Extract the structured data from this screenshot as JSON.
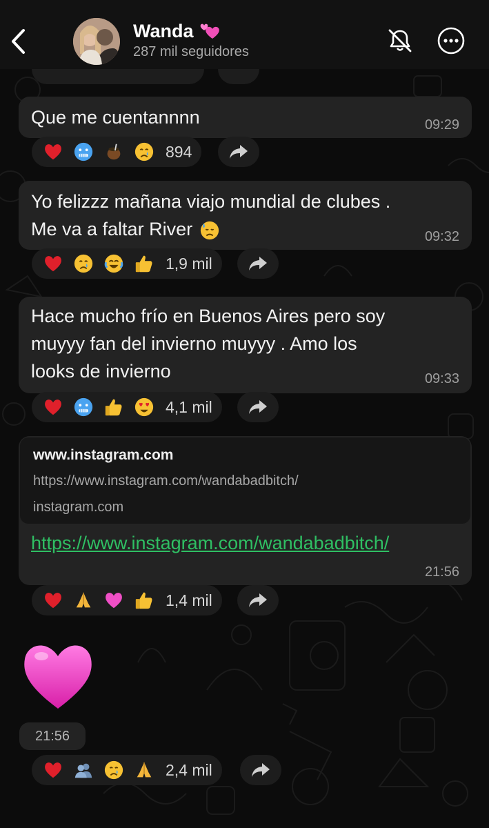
{
  "header": {
    "back_icon": "chevron-left-icon",
    "name": "Wanda",
    "name_emoji": "two-hearts",
    "subtitle": "287 mil seguidores",
    "mute_icon": "bell-off-icon",
    "more_icon": "more-horizontal-icon"
  },
  "messages": [
    {
      "text": "Que me cuentannnn",
      "time": "09:29",
      "reactions": [
        "red-heart",
        "cold-face",
        "mate",
        "crying-face"
      ],
      "reaction_count": "894"
    },
    {
      "text": "Yo felizzz mañana viajo  mundial de clubes .\nMe va a faltar River",
      "emoji": "downcast-sweat-face",
      "time": "09:32",
      "reactions": [
        "red-heart",
        "crying-face",
        "tears-of-joy",
        "thumbs-up"
      ],
      "reaction_count": "1,9 mil"
    },
    {
      "text": "Hace mucho frío en Buenos Aires pero soy\nmuyyy fan del invierno  muyyy . Amo los\nlooks de invierno",
      "time": "09:33",
      "reactions": [
        "red-heart",
        "cold-face",
        "thumbs-up",
        "heart-eyes"
      ],
      "reaction_count": "4,1 mil"
    },
    {
      "preview_title": "www.instagram.com",
      "preview_url": "https://www.instagram.com/wandabadbitch/",
      "preview_domain": "instagram.com",
      "link": "https://www.instagram.com/wandabadbitch/",
      "time": "21:56",
      "reactions": [
        "red-heart",
        "folded-hands",
        "pink-heart",
        "thumbs-up"
      ],
      "reaction_count": "1,4 mil"
    },
    {
      "sticker": "pink-heart",
      "time": "21:56",
      "reactions": [
        "red-heart",
        "busts-in-silhouette",
        "crying-face",
        "folded-hands"
      ],
      "reaction_count": "2,4 mil"
    }
  ],
  "colors": {
    "background": "#0c0c0c",
    "bubble": "#232323",
    "link": "#2fbf63",
    "timestamp": "#9e9e9e"
  }
}
